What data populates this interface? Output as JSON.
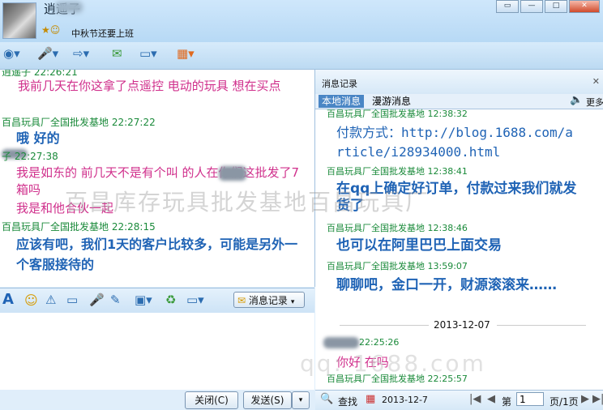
{
  "title": {
    "contact_name": "逍遥子",
    "signature": "中秋节还要上班",
    "status_icons": "★☺"
  },
  "window_buttons": [
    "▭",
    "—",
    "□",
    "✕"
  ],
  "toolbar": [
    "◉▾",
    "🎤▾",
    "⇨▾",
    "✉",
    "▭▾",
    "▦▾"
  ],
  "chat": {
    "messages": [
      {
        "head": "逍遥子  22:26:21",
        "text": "我前几天在你这拿了点遥控   电动的玩具     想在买点",
        "style": "pink"
      },
      {
        "head": "百昌玩具厂全国批发基地  22:27:22",
        "text": "哦 好的",
        "style": "blue"
      },
      {
        "head": "     子  22:27:38",
        "text": "我是如东的      前几天不是有个叫       的人在你们这批发了7箱吗",
        "style": "pink"
      },
      {
        "head": "",
        "text": "我是和他合伙一起",
        "style": "pink"
      },
      {
        "head": "百昌玩具厂全国批发基地  22:28:15",
        "text": "应该有吧，我们1天的客户比较多，可能是另外一个客服接待的",
        "style": "blue"
      }
    ]
  },
  "input_toolbar": {
    "history_button": "消息记录"
  },
  "buttons": {
    "close": "关闭(C)",
    "send": "发送(S)"
  },
  "history": {
    "title": "消息记录",
    "tabs": [
      "本地消息",
      "漫游消息"
    ],
    "more": "更多",
    "entries": [
      {
        "head": "百昌玩具厂全国批发基地 12:38:32",
        "text": "付款方式：http://blog.1688.com/article/i28934000.html"
      },
      {
        "head": "百昌玩具厂全国批发基地 12:38:41",
        "text": "在qq上确定好订单，付款过来我们就发货了"
      },
      {
        "head": "百昌玩具厂全国批发基地 12:38:46",
        "text": "也可以在阿里巴巴上面交易"
      },
      {
        "head": "百昌玩具厂全国批发基地 13:59:07",
        "text": "聊聊吧，金口一开，财源滚滚来……"
      }
    ],
    "date_divider": "2013-12-07",
    "entry_after_date": {
      "head": "22:25:26",
      "text": "你好   在吗"
    },
    "last_head": "百昌玩具厂全国批发基地 22:25:57",
    "search": "查找",
    "date_box": "2013-12-7",
    "page_label": "第",
    "page_value": "1",
    "page_total": "页/1页"
  },
  "watermark": "百昌库存玩具批发基地百昌玩具厂",
  "watermark2": "qq:        1688.com"
}
